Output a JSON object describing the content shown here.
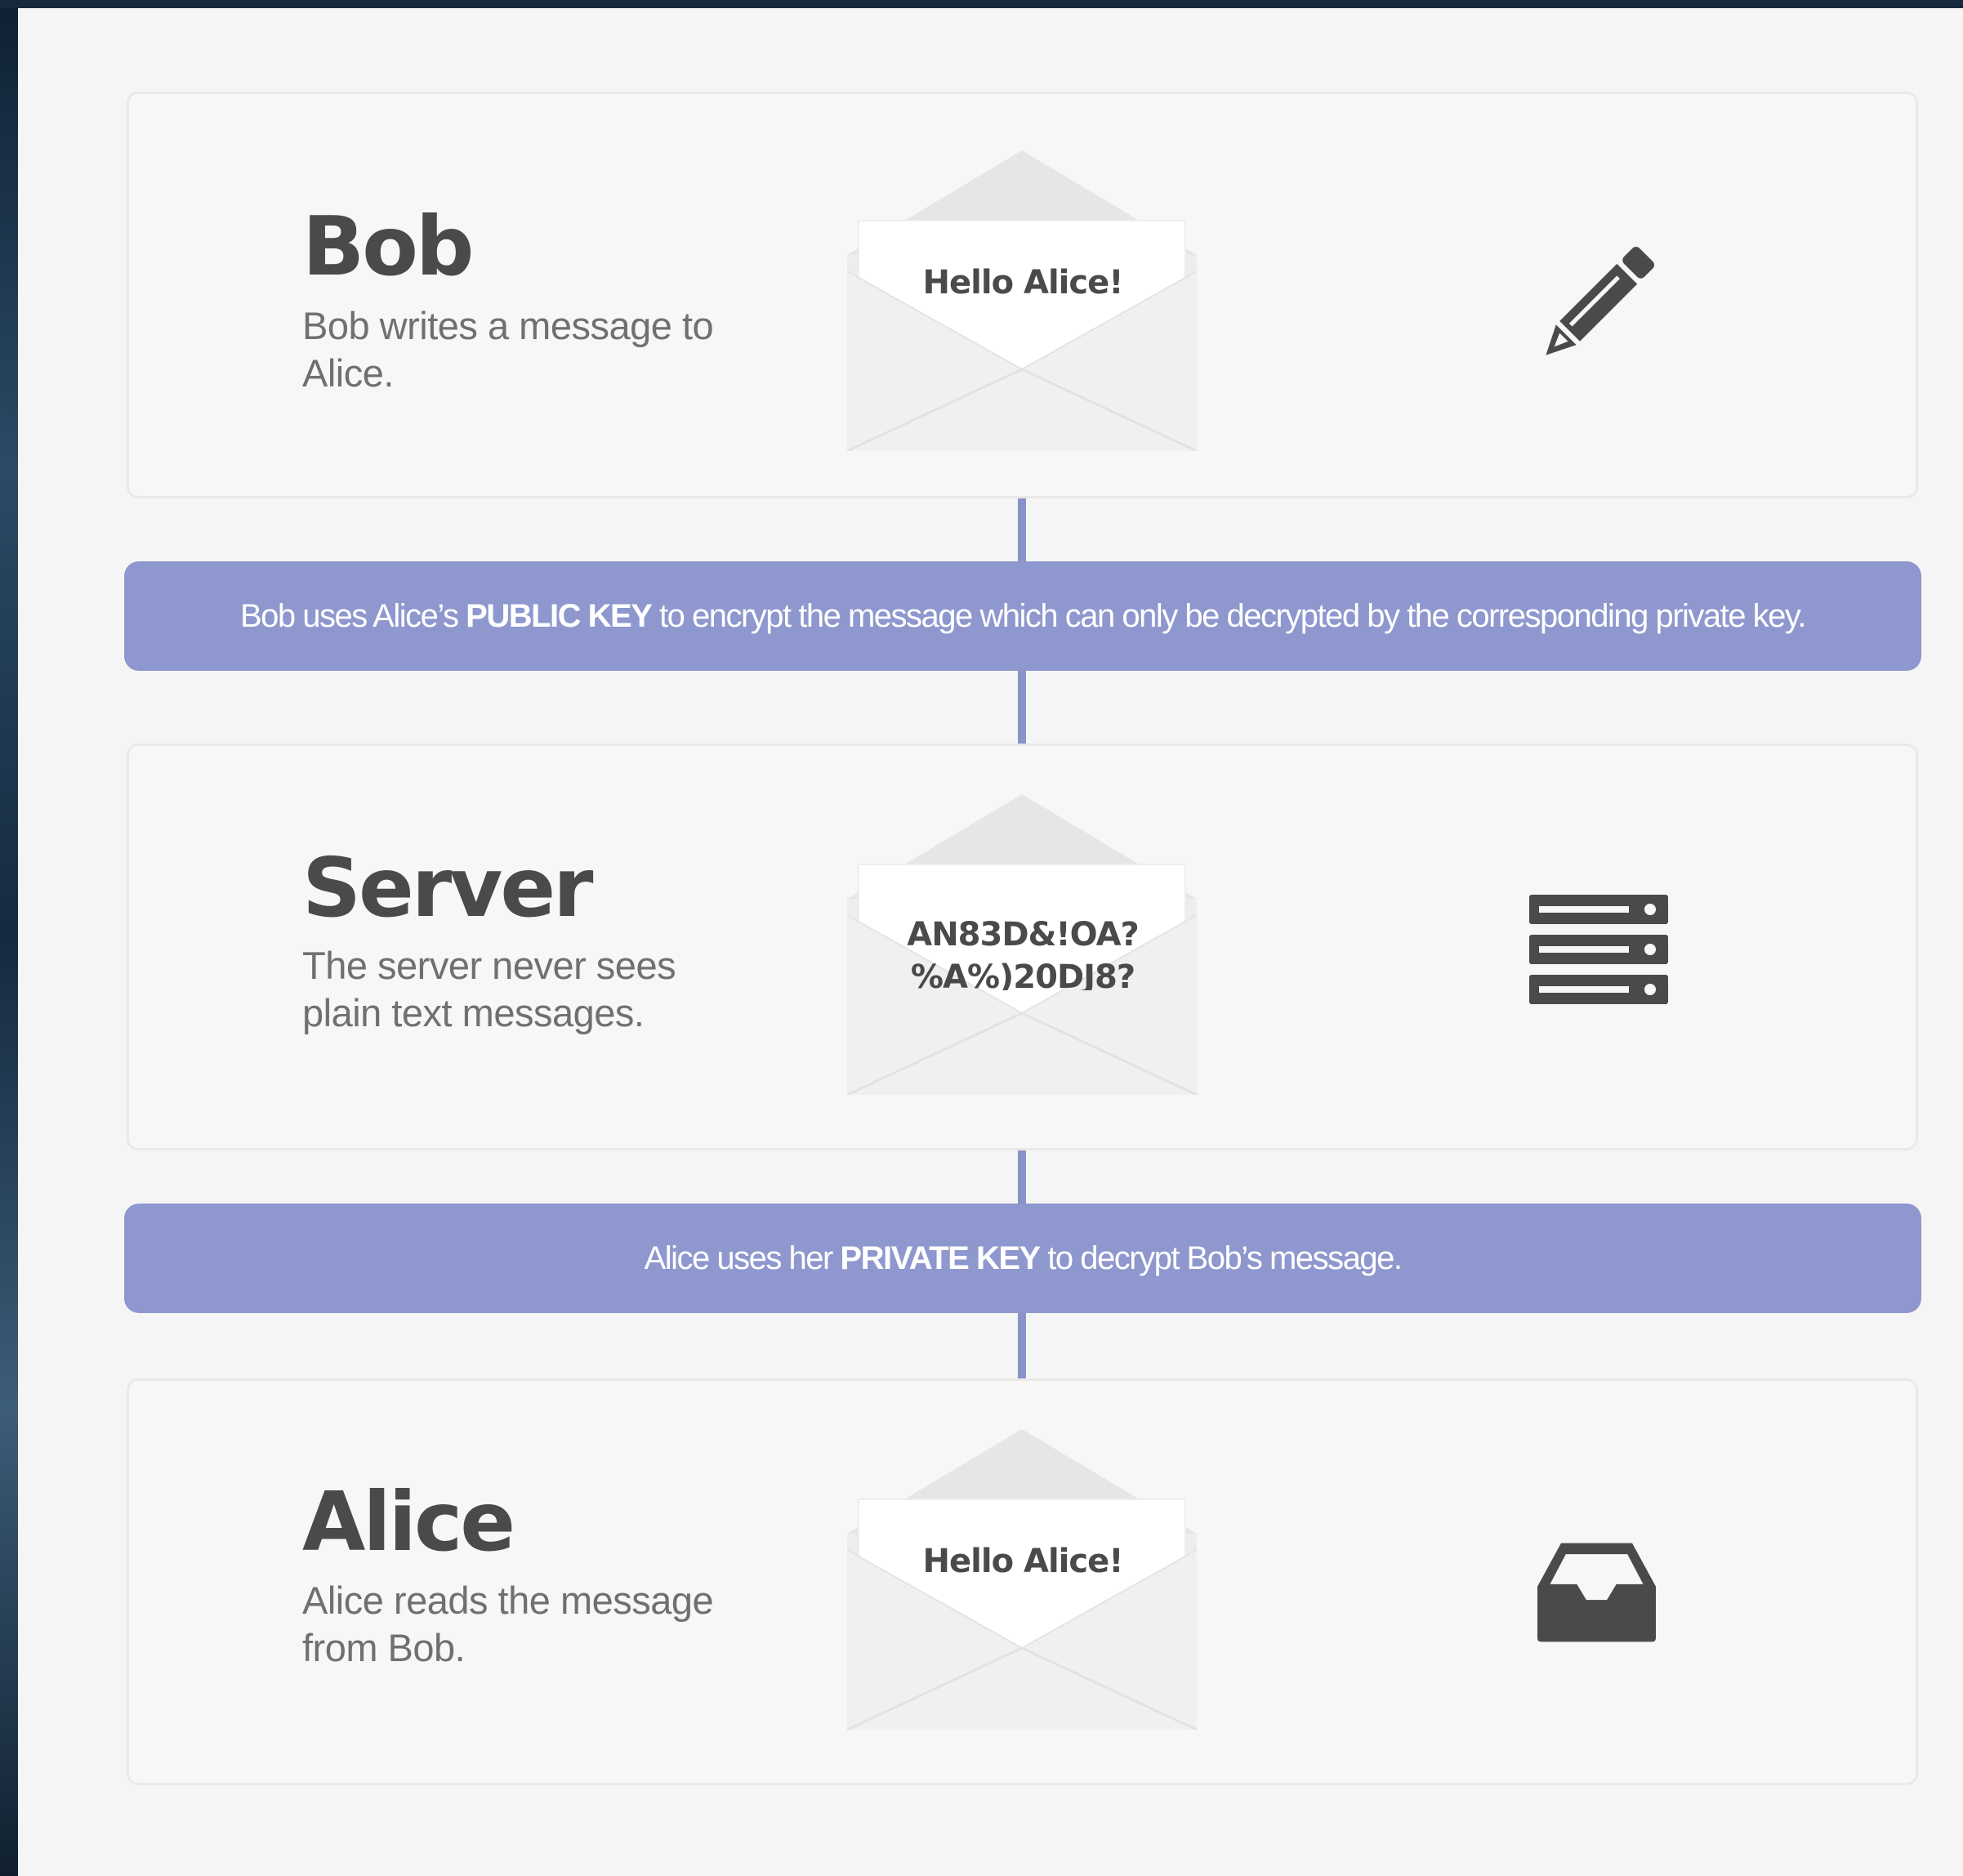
{
  "stages": [
    {
      "title": "Bob",
      "description": "Bob writes a message to Alice.",
      "envelope_text": "Hello Alice!",
      "icon": "pencil-icon"
    },
    {
      "title": "Server",
      "description": "The server never sees plain text messages.",
      "envelope_text": "AN83D&!OA?\n%A%)20DJ8?",
      "icon": "server-icon"
    },
    {
      "title": "Alice",
      "description": "Alice reads the message from Bob.",
      "envelope_text": "Hello Alice!",
      "icon": "inbox-icon"
    }
  ],
  "banners": [
    {
      "before": "Bob uses Alice’s ",
      "key": "PUBLIC KEY",
      "after": " to encrypt the message which can only be decrypted by the corresponding private key."
    },
    {
      "before": "Alice uses her ",
      "key": "PRIVATE KEY",
      "after": " to decrypt Bob’s message."
    }
  ],
  "colors": {
    "banner": "#8e97ce",
    "connector": "#8a93c7",
    "heading": "#4a4a4a",
    "body_text": "#707070"
  }
}
